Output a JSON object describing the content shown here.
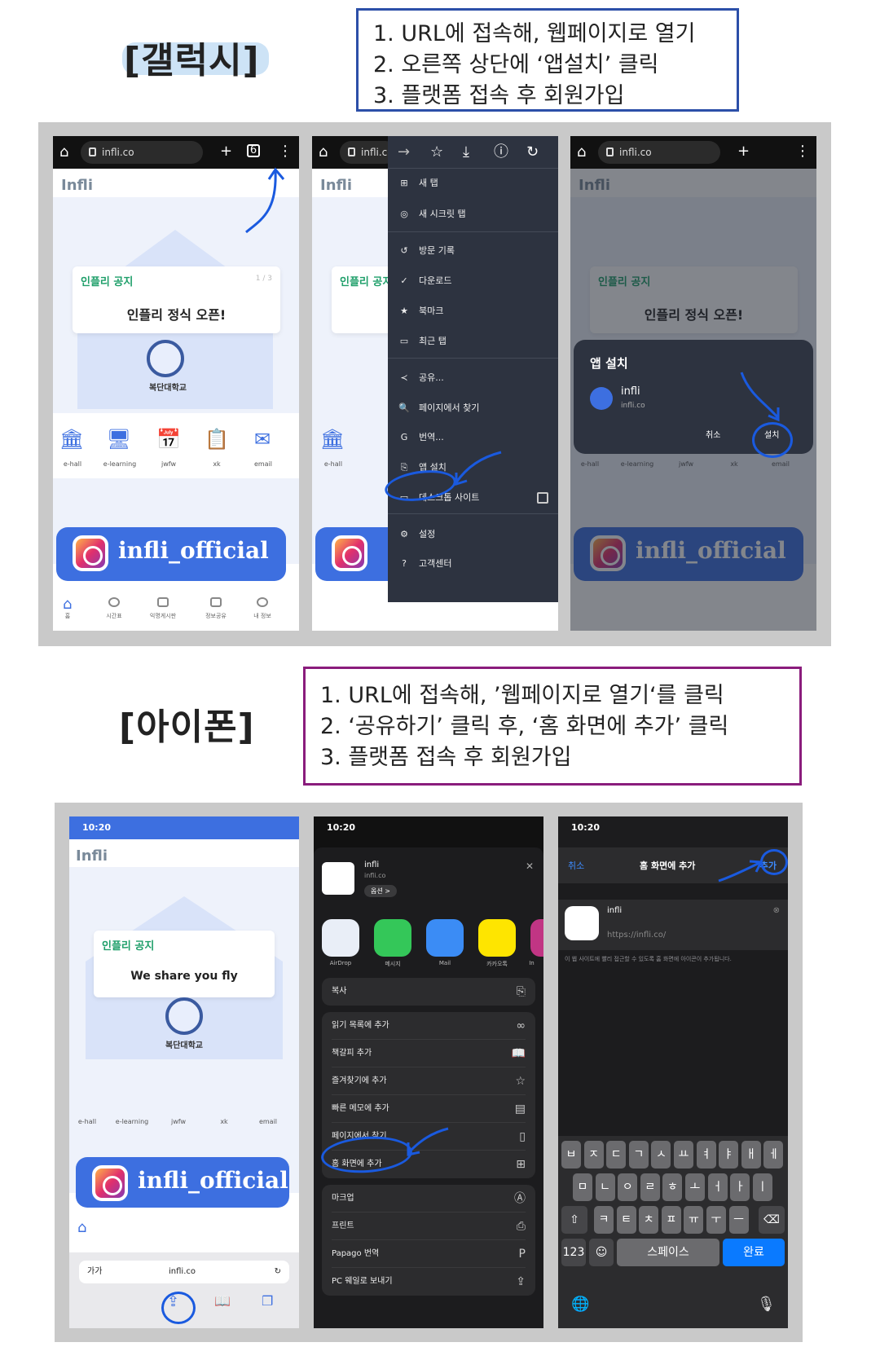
{
  "galaxy": {
    "title": "[갤럭시]",
    "steps": [
      "1. URL에 접속해, 웹페이지로 열기",
      "2. 오른쪽 상단에 ‘앱설치’ 클릭",
      "3. 플랫폼 접속 후 회원가입"
    ],
    "box_color": "#2c4fa8"
  },
  "iphone": {
    "title": "[아이폰]",
    "steps": [
      "1. URL에 접속해, ’웹페이지로 열기‘를 클릭",
      "2. ‘공유하기’ 클릭 후, ‘홈 화면에 추가’ 클릭",
      "3. 플랫폼 접속 후 회원가입"
    ],
    "box_color": "#8a1c7c"
  },
  "app": {
    "url": "infli.co",
    "logo": "Infli",
    "notice_label": "인플리 공지",
    "notice_pager": "1 / 3",
    "notice_title": "인플리 정식 오픈!",
    "notice_title_iphone": "We share you fly",
    "univ": "복단대학교",
    "quick": [
      "e-hall",
      "e-learning",
      "jwfw",
      "xk",
      "email"
    ],
    "insta": "infli_official",
    "tabs": [
      "홈",
      "시간표",
      "익명게시판",
      "정보공유",
      "내 정보"
    ]
  },
  "chrome_menu": {
    "items": [
      "새 탭",
      "새 시크릿 탭",
      "방문 기록",
      "다운로드",
      "북마크",
      "최근 탭",
      "공유...",
      "페이지에서 찾기",
      "번역...",
      "앱 설치",
      "데스크톱 사이트",
      "설정",
      "고객센터"
    ]
  },
  "install_dialog": {
    "title": "앱 설치",
    "app_name": "infli",
    "app_url": "infli.co",
    "cancel": "취소",
    "install": "설치"
  },
  "ios": {
    "time": "10:20",
    "safari_aa": "가가",
    "share": {
      "name": "infli",
      "url": "infli.co",
      "options": "옵션 >",
      "apps": [
        "AirDrop",
        "메시지",
        "Mail",
        "카카오톡",
        "In"
      ],
      "copy": "복사",
      "rows1": [
        "읽기 목록에 추가",
        "책갈피 추가",
        "즐겨찾기에 추가",
        "빠른 메모에 추가",
        "페이지에서 찾기",
        "홈 화면에 추가"
      ],
      "rows2": [
        "마크업",
        "프린트",
        "Papago 번역",
        "PC 웨일로 보내기"
      ]
    },
    "add_home": {
      "cancel": "취소",
      "title": "홈 화면에 추가",
      "add": "추가",
      "name": "infli",
      "url": "https://infli.co/",
      "note": "이 웹 사이트에 빨리 접근할 수 있도록 홈 화면에 아이콘이 추가됩니다."
    },
    "keyboard": {
      "row1": [
        "ㅂ",
        "ㅈ",
        "ㄷ",
        "ㄱ",
        "ㅅ",
        "ㅛ",
        "ㅕ",
        "ㅑ",
        "ㅐ",
        "ㅔ"
      ],
      "row2": [
        "ㅁ",
        "ㄴ",
        "ㅇ",
        "ㄹ",
        "ㅎ",
        "ㅗ",
        "ㅓ",
        "ㅏ",
        "ㅣ"
      ],
      "row3": [
        "ㅋ",
        "ㅌ",
        "ㅊ",
        "ㅍ",
        "ㅠ",
        "ㅜ",
        "ㅡ"
      ],
      "num": "123",
      "space": "스페이스",
      "done": "완료"
    }
  },
  "colors": {
    "annotation": "#1a5adf",
    "brand": "#3d6fe0",
    "panel": "#c9c9c9"
  }
}
